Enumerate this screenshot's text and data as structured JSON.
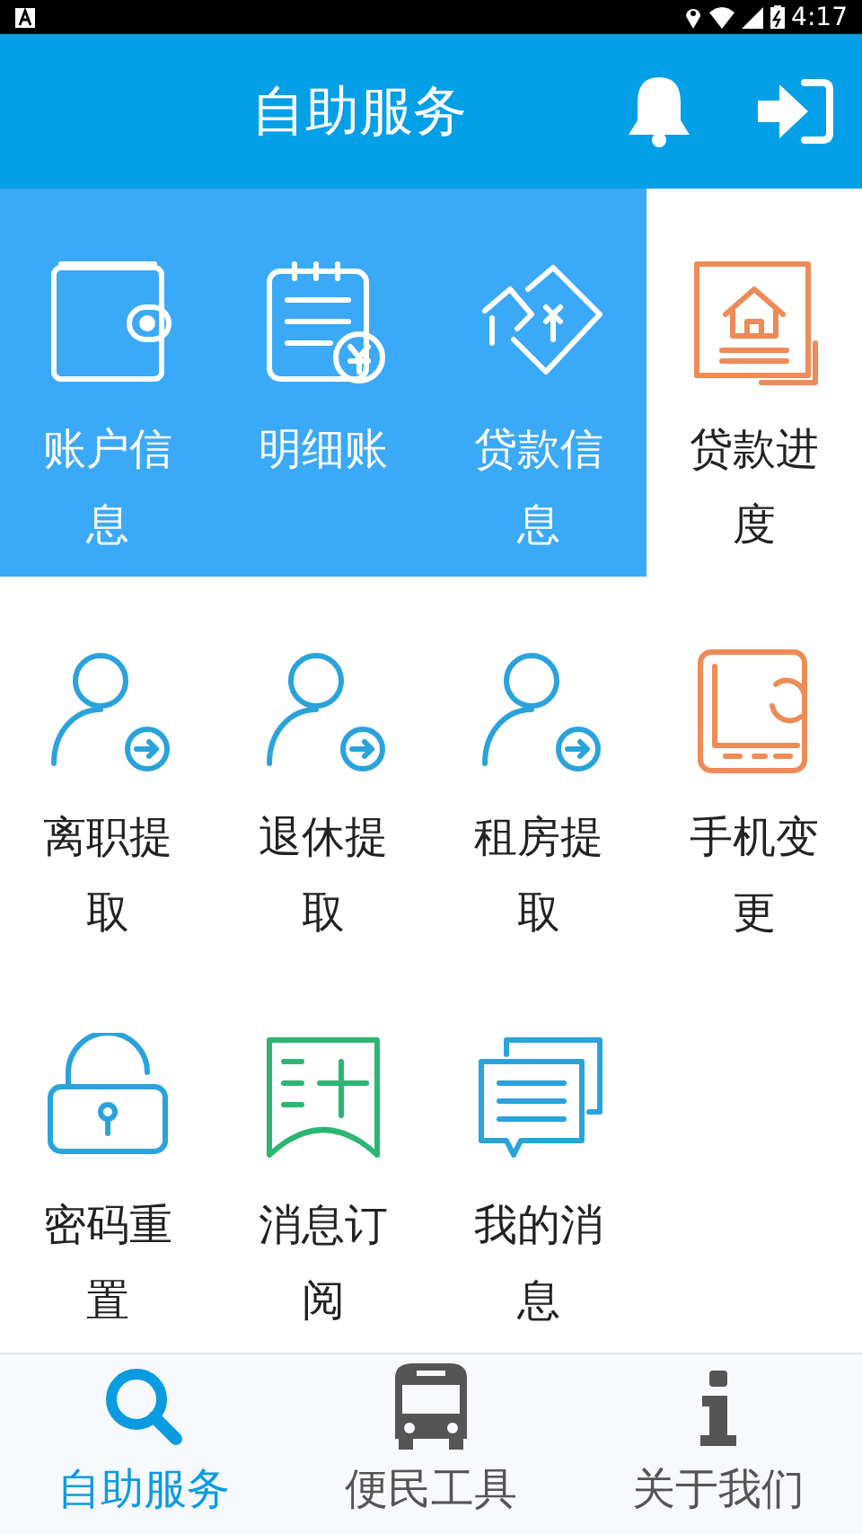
{
  "status_bar": {
    "time": "4:17"
  },
  "header": {
    "title": "自助服务"
  },
  "tiles": [
    {
      "label": "账户信息",
      "kind": "wallet",
      "color": "#ffffff",
      "highlighted": true
    },
    {
      "label": "明细账",
      "kind": "ledger",
      "color": "#ffffff",
      "highlighted": true
    },
    {
      "label": "贷款信息",
      "kind": "loan",
      "color": "#ffffff",
      "highlighted": true
    },
    {
      "label": "贷款进度",
      "kind": "house",
      "color": "#ee8b56",
      "highlighted": false
    },
    {
      "label": "离职提取",
      "kind": "person",
      "color": "#2aa3dc",
      "highlighted": false
    },
    {
      "label": "退休提取",
      "kind": "person",
      "color": "#2aa3dc",
      "highlighted": false
    },
    {
      "label": "租房提取",
      "kind": "person",
      "color": "#2aa3dc",
      "highlighted": false
    },
    {
      "label": "手机变更",
      "kind": "phone",
      "color": "#ee8b56",
      "highlighted": false
    },
    {
      "label": "密码重置",
      "kind": "lock",
      "color": "#2aa3dc",
      "highlighted": false
    },
    {
      "label": "消息订阅",
      "kind": "bookmark",
      "color": "#2bb673",
      "highlighted": false
    },
    {
      "label": "我的消息",
      "kind": "chat",
      "color": "#2aa3dc",
      "highlighted": false
    }
  ],
  "bottom_nav": [
    {
      "label": "自助服务",
      "kind": "search",
      "selected": true
    },
    {
      "label": "便民工具",
      "kind": "bus",
      "selected": false
    },
    {
      "label": "关于我们",
      "kind": "info",
      "selected": false
    }
  ]
}
